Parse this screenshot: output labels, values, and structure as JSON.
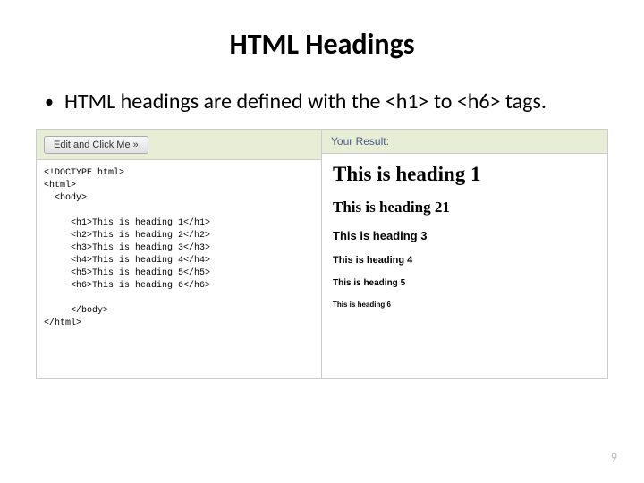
{
  "title": "HTML Headings",
  "bullet": "HTML headings are defined with the <h1> to <h6> tags.",
  "editor": {
    "button_label": "Edit and Click Me »",
    "code": "<!DOCTYPE html>\n<html>\n  <body>\n\n     <h1>This is heading 1</h1>\n     <h2>This is heading 2</h2>\n     <h3>This is heading 3</h3>\n     <h4>This is heading 4</h4>\n     <h5>This is heading 5</h5>\n     <h6>This is heading 6</h6>\n\n     </body>\n</html>"
  },
  "result": {
    "header": "Your Result:",
    "h1": "This is heading 1",
    "h2": "This is heading 21",
    "h3": "This is heading 3",
    "h4": "This is heading 4",
    "h5": "This is heading 5",
    "h6": "This is heading 6"
  },
  "page_number": "9"
}
